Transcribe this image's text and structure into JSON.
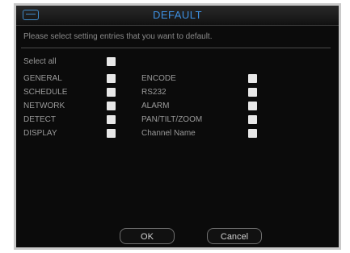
{
  "window": {
    "title": "DEFAULT",
    "icon": "window-icon"
  },
  "prompt": "Please select setting entries that you want to default.",
  "select_all": {
    "label": "Select all"
  },
  "left_items": [
    {
      "label": "GENERAL"
    },
    {
      "label": "SCHEDULE"
    },
    {
      "label": "NETWORK"
    },
    {
      "label": "DETECT"
    },
    {
      "label": "DISPLAY"
    }
  ],
  "right_items": [
    {
      "label": "ENCODE"
    },
    {
      "label": "RS232"
    },
    {
      "label": "ALARM"
    },
    {
      "label": "PAN/TILT/ZOOM"
    },
    {
      "label": "Channel Name"
    }
  ],
  "buttons": {
    "ok": "OK",
    "cancel": "Cancel"
  },
  "colors": {
    "background": "#0b0b0b",
    "title": "#3d8fe0",
    "text": "#9a9a9a",
    "checkbox": "#e8e8e8"
  }
}
